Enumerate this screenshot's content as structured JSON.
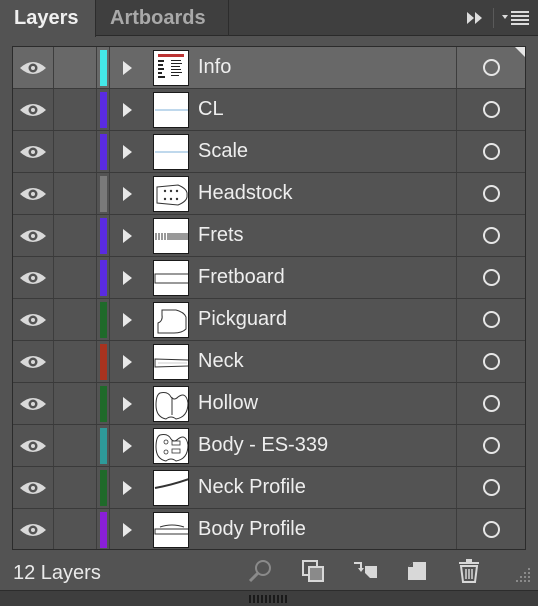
{
  "tabs": [
    {
      "label": "Layers",
      "active": true
    },
    {
      "label": "Artboards",
      "active": false
    }
  ],
  "panel_icons": [
    "collapse-double-arrow-icon",
    "panel-menu-icon"
  ],
  "layers": [
    {
      "name": "Info",
      "color": "#44e8e8",
      "selected": true,
      "thumb": "info"
    },
    {
      "name": "CL",
      "color": "#5a2be0",
      "selected": false,
      "thumb": "line"
    },
    {
      "name": "Scale",
      "color": "#5a2be0",
      "selected": false,
      "thumb": "line"
    },
    {
      "name": "Headstock",
      "color": "#7a7a7a",
      "selected": false,
      "thumb": "headstock"
    },
    {
      "name": "Frets",
      "color": "#5a2be0",
      "selected": false,
      "thumb": "frets"
    },
    {
      "name": "Fretboard",
      "color": "#5a2be0",
      "selected": false,
      "thumb": "fretboard"
    },
    {
      "name": "Pickguard",
      "color": "#1f6a2a",
      "selected": false,
      "thumb": "pickguard"
    },
    {
      "name": "Neck",
      "color": "#a8331f",
      "selected": false,
      "thumb": "neck"
    },
    {
      "name": "Hollow",
      "color": "#1f6a2a",
      "selected": false,
      "thumb": "body"
    },
    {
      "name": "Body - ES-339",
      "color": "#2e9a9a",
      "selected": false,
      "thumb": "body2"
    },
    {
      "name": "Neck Profile",
      "color": "#1f6a2a",
      "selected": false,
      "thumb": "neckprofile"
    },
    {
      "name": "Body Profile",
      "color": "#8a1fd8",
      "selected": false,
      "thumb": "bodyprofile"
    }
  ],
  "footer": {
    "count_label": "12 Layers",
    "icons": [
      "locate-object-icon",
      "make-clipping-mask-icon",
      "create-sublayer-icon",
      "new-layer-icon",
      "delete-layer-icon"
    ]
  }
}
